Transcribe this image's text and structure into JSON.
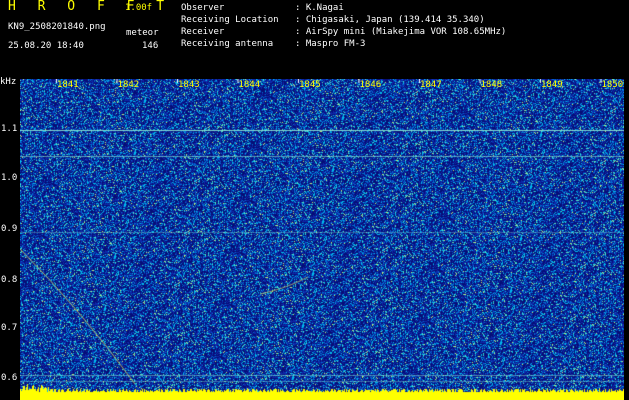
{
  "app": {
    "title": "H R O F F T",
    "version": "1.00f",
    "file": "KN9_2508201840.png",
    "datetime": "25.08.20 18:40",
    "mode": "meteor",
    "count": "146"
  },
  "info": [
    {
      "label": "Observer",
      "value": ": K.Nagai"
    },
    {
      "label": "Receiving Location",
      "value": ": Chigasaki, Japan (139.414 35.340)"
    },
    {
      "label": "Receiver",
      "value": ": AirSpy mini (Miakejima VOR 108.65MHz)"
    },
    {
      "label": "Receiving antenna",
      "value": ": Maspro FM-3"
    }
  ],
  "axis": {
    "y_unit": "kHz",
    "y_ticks": [
      "1.1",
      "1.0",
      "0.9",
      "0.8",
      "0.7",
      "0.6"
    ],
    "x_ticks": [
      "1841",
      "1842",
      "1843",
      "1844",
      "1845",
      "1846",
      "1847",
      "1848",
      "1849",
      "1850"
    ]
  },
  "colors": {
    "background": "#000000",
    "header_accent": "#ffff00",
    "spectrogram_base": "#0a1a9c",
    "noise_cyan": "#00c8ff",
    "noise_green": "#6cf2b0",
    "bottom_band": "#ffff00"
  }
}
